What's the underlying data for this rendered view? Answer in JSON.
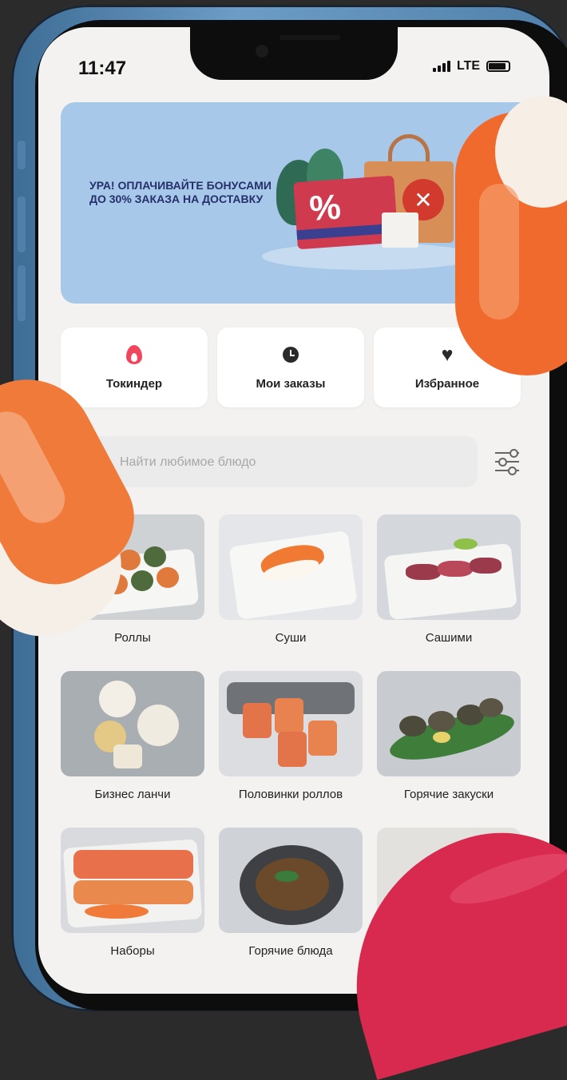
{
  "status_bar": {
    "time": "11:47",
    "network": "LTE"
  },
  "banner": {
    "text": "Ура! Оплачивайте бонусами до 30% заказа на доставку",
    "graphic_text": "%"
  },
  "quick_actions": [
    {
      "label": "Токиндер",
      "icon": "flame-icon",
      "color": "#f0455c"
    },
    {
      "label": "Мои заказы",
      "icon": "clock-icon",
      "color": "#2a2a2a"
    },
    {
      "label": "Избранное",
      "icon": "heart-icon",
      "color": "#2a2a2a"
    }
  ],
  "search": {
    "placeholder": "Найти любимое блюдо",
    "value": ""
  },
  "categories": [
    {
      "label": "Роллы"
    },
    {
      "label": "Суши"
    },
    {
      "label": "Сашими"
    },
    {
      "label": "Бизнес ланчи"
    },
    {
      "label": "Половинки роллов"
    },
    {
      "label": "Горячие закуски"
    },
    {
      "label": "Наборы"
    },
    {
      "label": "Горячие блюда"
    },
    {
      "label": ""
    }
  ],
  "colors": {
    "background": "#2b2b2b",
    "screen": "#f3f2f1",
    "banner": "#a7c8e8",
    "banner_text": "#25306b",
    "accent": "#f0455c",
    "phone_frame": "#4f80aa"
  }
}
